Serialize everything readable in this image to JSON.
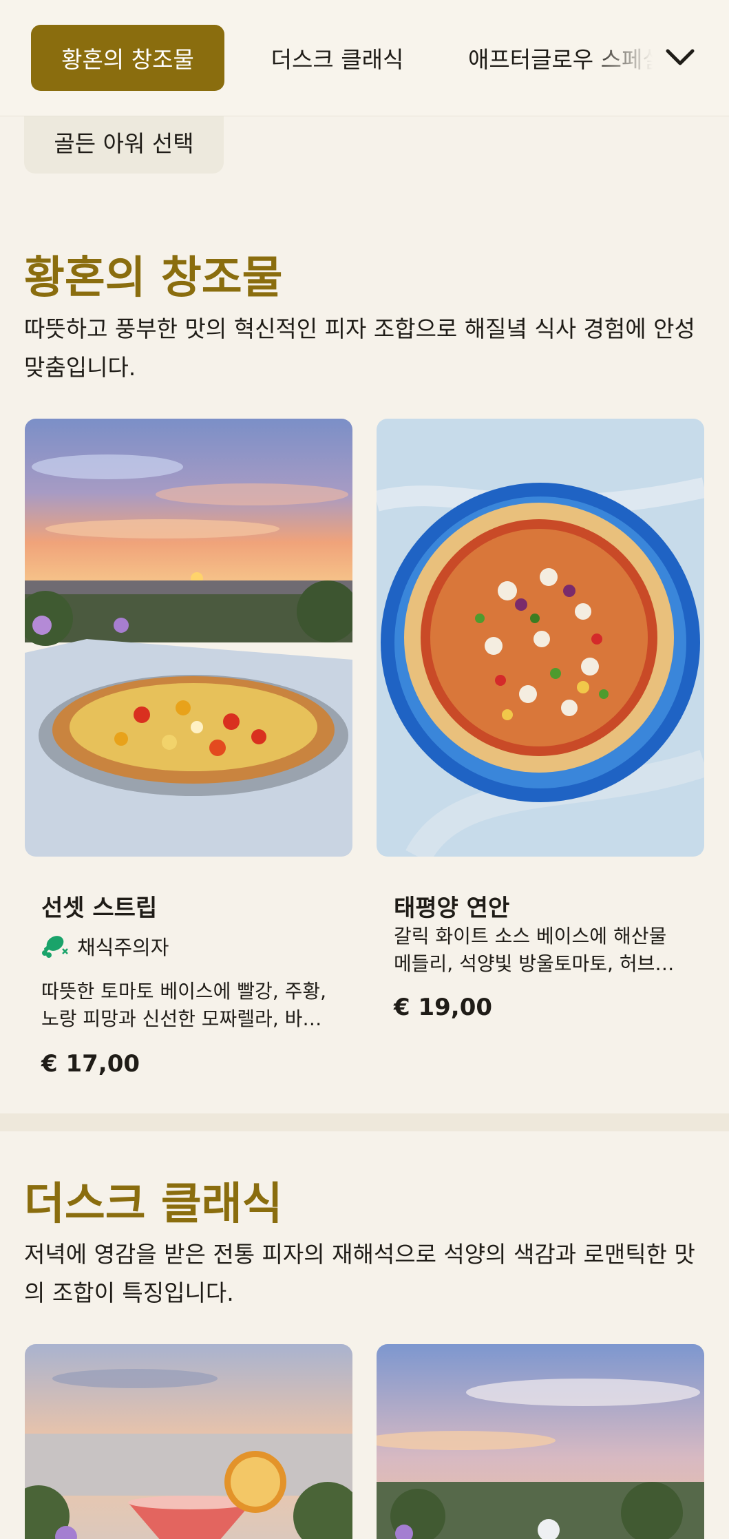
{
  "nav": {
    "tabs": [
      {
        "label": "황혼의 창조물",
        "active": true
      },
      {
        "label": "더스크 클래식",
        "active": false
      },
      {
        "label": "애프터글로우 스페셜",
        "active": false
      }
    ],
    "expand_icon": "chevron-down-icon",
    "subtab": "골든 아워 선택",
    "accent_color": "#8a6d0e"
  },
  "sections": [
    {
      "title": "황혼의 창조물",
      "description": "따뜻하고 풍부한 맛의 혁신적인 피자 조합으로 해질녘 식사 경험에 안성맞춤입니다.",
      "items": [
        {
          "name": "선셋 스트립",
          "tag": "채식주의자",
          "tag_icon": "vegetarian-drumstick-icon",
          "tag_color": "#1aa36a",
          "description": "따뜻한 토마토 베이스에 빨강, 주황, 노랑 피망과 신선한 모짜렐라, 바질을 얹은 피자",
          "price": "€ 17,00"
        },
        {
          "name": "태평양 연안",
          "description": "갈릭 화이트 소스 베이스에 해산물 메들리, 석양빛 방울토마토, 허브를 곁들인 피자",
          "price": "€ 19,00"
        }
      ]
    },
    {
      "title": "더스크 클래식",
      "description": "저녁에 영감을 받은 전통 피자의 재해석으로 석양의 색감과 로맨틱한 맛의 조합이 특징입니다."
    }
  ]
}
